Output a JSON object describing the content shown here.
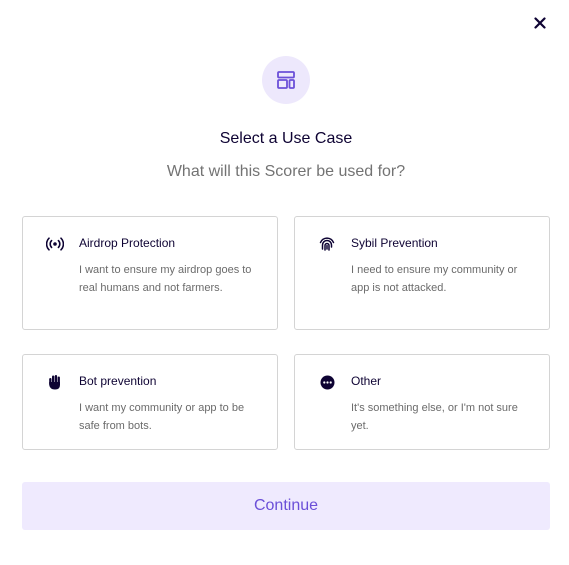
{
  "dialog": {
    "title": "Select a Use Case",
    "subtitle": "What will this Scorer be used for?",
    "close_icon": "close-icon",
    "hero_icon": "layout-template-icon"
  },
  "options": [
    {
      "icon": "broadcast-icon",
      "title": "Airdrop Protection",
      "description": "I want to ensure my airdrop goes to real humans and not farmers."
    },
    {
      "icon": "fingerprint-icon",
      "title": "Sybil Prevention",
      "description": "I need to ensure my community or app is not attacked."
    },
    {
      "icon": "hand-icon",
      "title": "Bot prevention",
      "description": "I want my community or app to be safe from bots."
    },
    {
      "icon": "ellipsis-circle-icon",
      "title": "Other",
      "description": "It's something else, or I'm not sure yet."
    }
  ],
  "continue_label": "Continue",
  "colors": {
    "accent": "#6b4fd8",
    "accent_light": "#ede8fc",
    "text_primary": "#0e0333",
    "text_secondary": "#737373",
    "border": "#d4d4d4"
  }
}
